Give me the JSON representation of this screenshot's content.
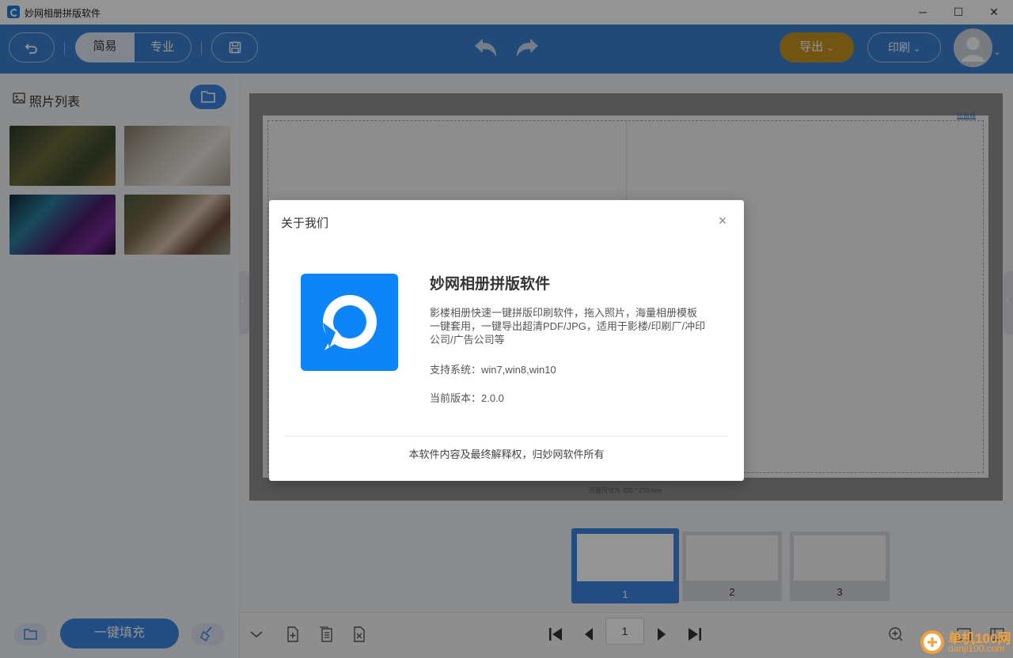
{
  "window": {
    "title": "妙网相册拼版软件",
    "minimize_icon": "─",
    "maximize_icon": "☐",
    "close_icon": "✕"
  },
  "toolbar": {
    "mode_easy": "简易",
    "mode_pro": "专业",
    "export_label": "导出",
    "print_label": "印刷",
    "accent_color": "#3a80d0",
    "export_color": "#c49321"
  },
  "left_panel": {
    "title": "照片列表",
    "fill_button": "一键填充"
  },
  "canvas": {
    "bleed_label": "出血线",
    "page_size_text": "页面尺寸为 420 * 210 mm"
  },
  "pages": {
    "items": [
      {
        "number": "1",
        "selected": true
      },
      {
        "number": "2",
        "selected": false
      },
      {
        "number": "3",
        "selected": false
      }
    ],
    "current_page": "1"
  },
  "dialog": {
    "title": "关于我们",
    "close_icon": "×",
    "app_name": "妙网相册拼版软件",
    "description": "影楼相册快速一键拼版印刷软件，拖入照片，海量相册模板一键套用，一键导出超清PDF/JPG，适用于影楼/印刷厂/冲印公司/广告公司等",
    "system": "支持系统：win7,win8,win10",
    "version": "当前版本：2.0.0",
    "footer": "本软件内容及最终解释权，归妙网软件所有",
    "logo_color": "#0d84f7"
  },
  "watermark": {
    "line1": "单机100网",
    "line2": "danji100.com"
  }
}
